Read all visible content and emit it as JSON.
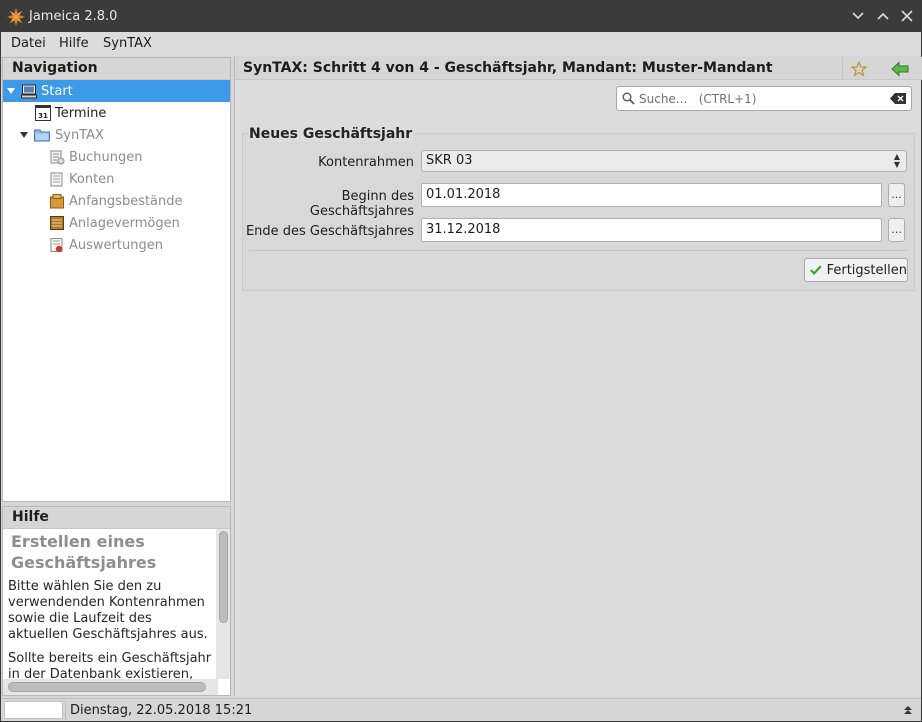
{
  "window": {
    "title": "Jameica 2.8.0"
  },
  "menu": [
    "Datei",
    "Hilfe",
    "SynTAX"
  ],
  "navigation": {
    "header": "Navigation",
    "items": [
      {
        "label": "Start",
        "icon": "computer-icon"
      },
      {
        "label": "Termine",
        "icon": "calendar-icon"
      },
      {
        "label": "SynTAX",
        "icon": "folder-icon"
      },
      {
        "label": "Buchungen",
        "icon": "bookings-icon"
      },
      {
        "label": "Konten",
        "icon": "accounts-icon"
      },
      {
        "label": "Anfangsbestände",
        "icon": "opening-balance-icon"
      },
      {
        "label": "Anlagevermögen",
        "icon": "fixed-assets-icon"
      },
      {
        "label": "Auswertungen",
        "icon": "reports-icon"
      }
    ],
    "calendar_badge": "31"
  },
  "help": {
    "header": "Hilfe",
    "title": "Erstellen eines Geschäftsjahres",
    "paragraphs": [
      "Bitte wählen Sie den zu verwendenden Kontenrahmen sowie die Laufzeit des aktuellen Geschäftsjahres aus.",
      "Sollte bereits ein Geschäftsjahr in der Datenbank existieren, dann"
    ]
  },
  "main": {
    "header": "SynTAX: Schritt 4 von 4 - Geschäftsjahr, Mandant: Muster-Mandant",
    "search_placeholder": "Suche...   (CTRL+1)",
    "group_title": "Neues Geschäftsjahr",
    "fields": {
      "kontenrahmen_label": "Kontenrahmen",
      "kontenrahmen_value": "SKR 03",
      "beginn_label": "Beginn des Geschäftsjahres",
      "beginn_value": "01.01.2018",
      "ende_label": "Ende des Geschäftsjahres",
      "ende_value": "31.12.2018",
      "dots": "..."
    },
    "finish_label": "Fertigstellen"
  },
  "status": {
    "text": "Dienstag, 22.05.2018 15:21"
  },
  "colors": {
    "selection": "#3d9ae8",
    "titlebar": "#3b3b3b",
    "accent_green": "#3aa336"
  }
}
